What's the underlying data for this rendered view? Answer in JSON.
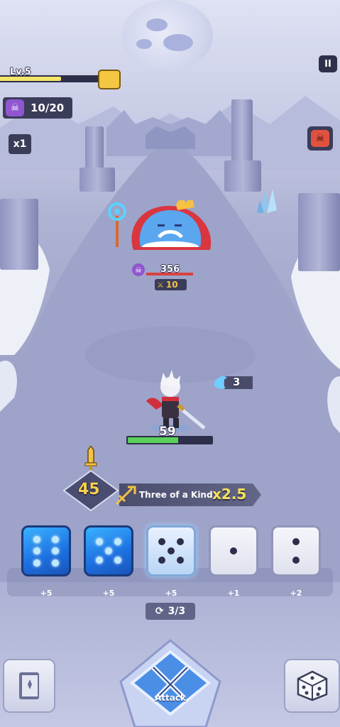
{
  "hud": {
    "level_label": "Lv.5",
    "xp_progress": 0.62,
    "kills_label": "10/20",
    "speed_label": "x1",
    "pause_label": "II"
  },
  "enemy": {
    "hp_label": "356",
    "attack_label": "10",
    "hp_fraction": 1.0
  },
  "hero": {
    "hp_label": "59",
    "hp_fraction": 0.6,
    "shield_label": "3"
  },
  "combo": {
    "score_label": "45",
    "hand_name": "Three of a Kind",
    "multiplier_label": "x2.5"
  },
  "dice": [
    {
      "face": 6,
      "style": "blue",
      "bonus": "+5"
    },
    {
      "face": 5,
      "style": "blue",
      "bonus": "+5"
    },
    {
      "face": 5,
      "style": "frost",
      "bonus": "+5"
    },
    {
      "face": 1,
      "style": "white",
      "bonus": "+1"
    },
    {
      "face": 2,
      "style": "white",
      "bonus": "+2"
    }
  ],
  "reroll_label": "3/3",
  "attack_button_label": "Attack",
  "colors": {
    "xp_fill": "#f3e56a",
    "hero_hp": "#5ad15a",
    "enemy_hp": "#d84242",
    "gold_text": "#f6d04d",
    "skull_purple": "#8f56cf",
    "boss_red": "#e0523f"
  }
}
